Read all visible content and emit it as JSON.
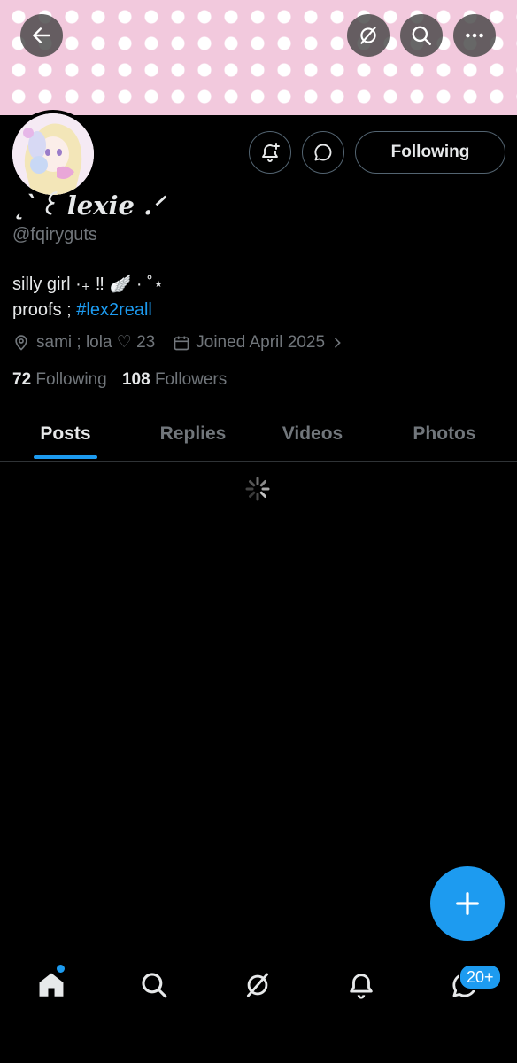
{
  "profile": {
    "name": "˛`꒰ lexie .ᐟ",
    "handle": "@fqiryguts",
    "bio_line1": "silly girl ·₊ ‼︎ 🪽 · ˚⋆",
    "bio_line2_prefix": "proofs ; ",
    "bio_hashtag": "#lex2reall",
    "location": "sami ; lola ♡ 23",
    "joined": "Joined April 2025",
    "following_count": "72",
    "following_label": "Following",
    "followers_count": "108",
    "followers_label": "Followers"
  },
  "actions": {
    "follow_state": "Following"
  },
  "tabs": [
    {
      "label": "Posts"
    },
    {
      "label": "Replies"
    },
    {
      "label": "Videos"
    },
    {
      "label": "Photos"
    }
  ],
  "nav": {
    "messages_badge": "20+"
  },
  "colors": {
    "accent": "#1d9bf0",
    "banner": "#f2c9dd",
    "muted": "#71767b"
  },
  "icons": {
    "back": "arrow-left-icon",
    "grok": "grok-icon",
    "search": "search-icon",
    "more": "more-icon",
    "notify": "bell-plus-icon",
    "message": "chat-bubble-icon",
    "location": "location-pin-icon",
    "calendar": "calendar-icon",
    "compose": "plus-icon",
    "home": "home-icon",
    "notifications": "bell-icon"
  }
}
